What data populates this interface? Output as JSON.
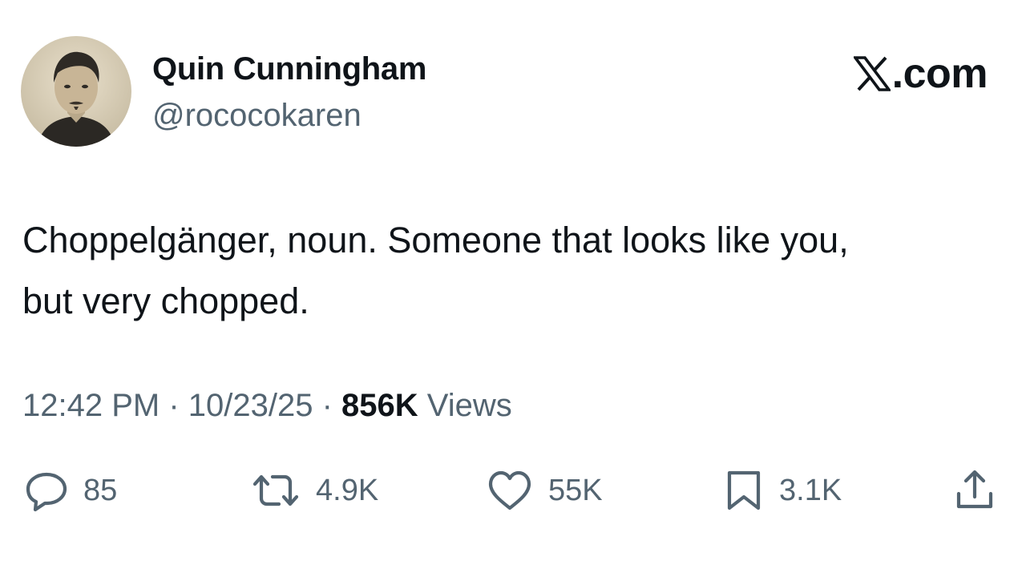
{
  "author": {
    "display_name": "Quin Cunningham",
    "handle": "@rococokaren"
  },
  "brand": {
    "text": ".com",
    "logo_icon": "x-logo-icon"
  },
  "tweet": {
    "text_lines": [
      "Choppelgänger, noun. Someone that looks like you,",
      "but very chopped."
    ]
  },
  "meta": {
    "time": "12:42 PM",
    "sep1": " · ",
    "date": "10/23/25",
    "sep2": " · ",
    "views_count": "856K",
    "views_label": " Views"
  },
  "actions": {
    "reply": {
      "icon": "reply-icon",
      "count": "85"
    },
    "repost": {
      "icon": "repost-icon",
      "count": "4.9K"
    },
    "like": {
      "icon": "heart-icon",
      "count": "55K"
    },
    "bookmark": {
      "icon": "bookmark-icon",
      "count": "3.1K"
    },
    "share": {
      "icon": "share-icon"
    }
  },
  "colors": {
    "primary_text": "#0f1419",
    "secondary_text": "#536471",
    "background": "#ffffff"
  }
}
